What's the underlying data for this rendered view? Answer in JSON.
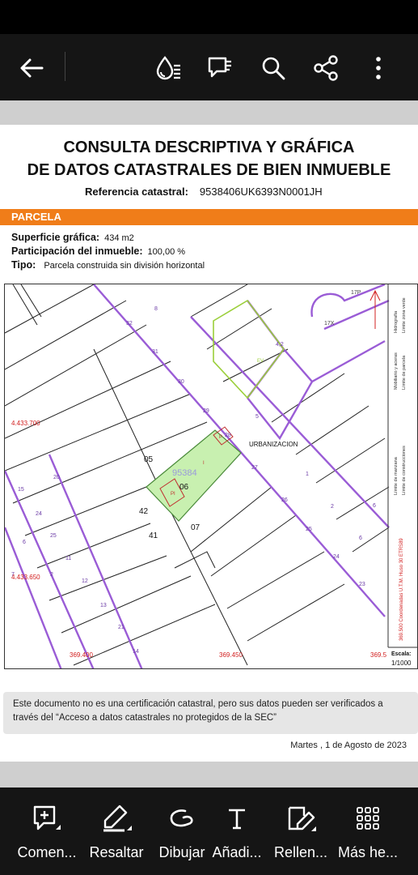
{
  "toolbar": {
    "icons": [
      "back-arrow-icon",
      "reading-mode-icon",
      "comment-icon",
      "search-icon",
      "share-icon",
      "more-vertical-icon"
    ]
  },
  "document": {
    "title_line1": "CONSULTA DESCRIPTIVA Y GRÁFICA",
    "title_line2": "DE DATOS CATASTRALES DE BIEN INMUEBLE",
    "ref_label": "Referencia catastral:",
    "ref_value": "9538406UK6393N0001JH",
    "section": "PARCELA",
    "surface_label": "Superficie gráfica:",
    "surface_value": "434 m2",
    "participation_label": "Participación del inmueble:",
    "participation_value": "100,00 %",
    "type_label": "Tipo:",
    "type_value": "Parcela construida sin división horizontal",
    "notice_line1": "Este documento no es una certificación catastral, pero sus datos pueden ser verificados a",
    "notice_line2": "través del “Acceso a datos catastrales no protegidos de la SEC”",
    "date": "Martes , 1 de Agosto de 2023"
  },
  "map": {
    "urbanizacion": "URBANIZACION",
    "parcel_ref": "95384",
    "parcel_06": "06",
    "parcel_05": "05",
    "parcel_42": "42",
    "parcel_41": "41",
    "parcel_07": "07",
    "coord_y1": "4.433.700",
    "coord_y2": "4.433.650",
    "coord_x1": "369.400",
    "coord_x2": "369.450",
    "coord_x3": "369.5",
    "label_17p": "17P",
    "label_17x": "17X",
    "label_p": "P",
    "label_i": "I",
    "label_pi": "PI",
    "label_ev": "EV",
    "street_numbers": [
      "32",
      "31",
      "30",
      "29",
      "28",
      "5",
      "27",
      "26",
      "25",
      "24",
      "23",
      "2",
      "6",
      "4,2",
      "8",
      "1",
      "6",
      "11",
      "21",
      "12",
      "13",
      "14",
      "15",
      "24",
      "25",
      "20",
      "6",
      "7",
      "2"
    ],
    "legend_1": "Límite de manzana",
    "legend_2": "Límite de parcela",
    "legend_3": "Límite de construcciones",
    "legend_4": "Mobiliario y aceras",
    "legend_5": "Límite zona verde",
    "legend_6": "Hidrografía",
    "legend_coords": "369.500 Coordenadas U.T.M. Huso 30 ETRS89",
    "scale_label": "Escala:",
    "scale_value": "1/1000"
  },
  "bottom_tools": [
    {
      "label": "Comen...",
      "icon": "add-comment-icon"
    },
    {
      "label": "Resaltar",
      "icon": "highlighter-icon"
    },
    {
      "label": "Dibujar",
      "icon": "draw-icon"
    },
    {
      "label": "Añadi...",
      "icon": "add-text-icon"
    },
    {
      "label": "Rellen...",
      "icon": "fill-sign-icon"
    },
    {
      "label": "Más he...",
      "icon": "more-tools-grid-icon"
    }
  ],
  "colors": {
    "accent_orange": "#f07d19",
    "block_purple": "#9a5cd6",
    "parcel_green": "#c8f0b0",
    "zone_green": "#9bcf3a",
    "coord_red": "#d22020"
  }
}
